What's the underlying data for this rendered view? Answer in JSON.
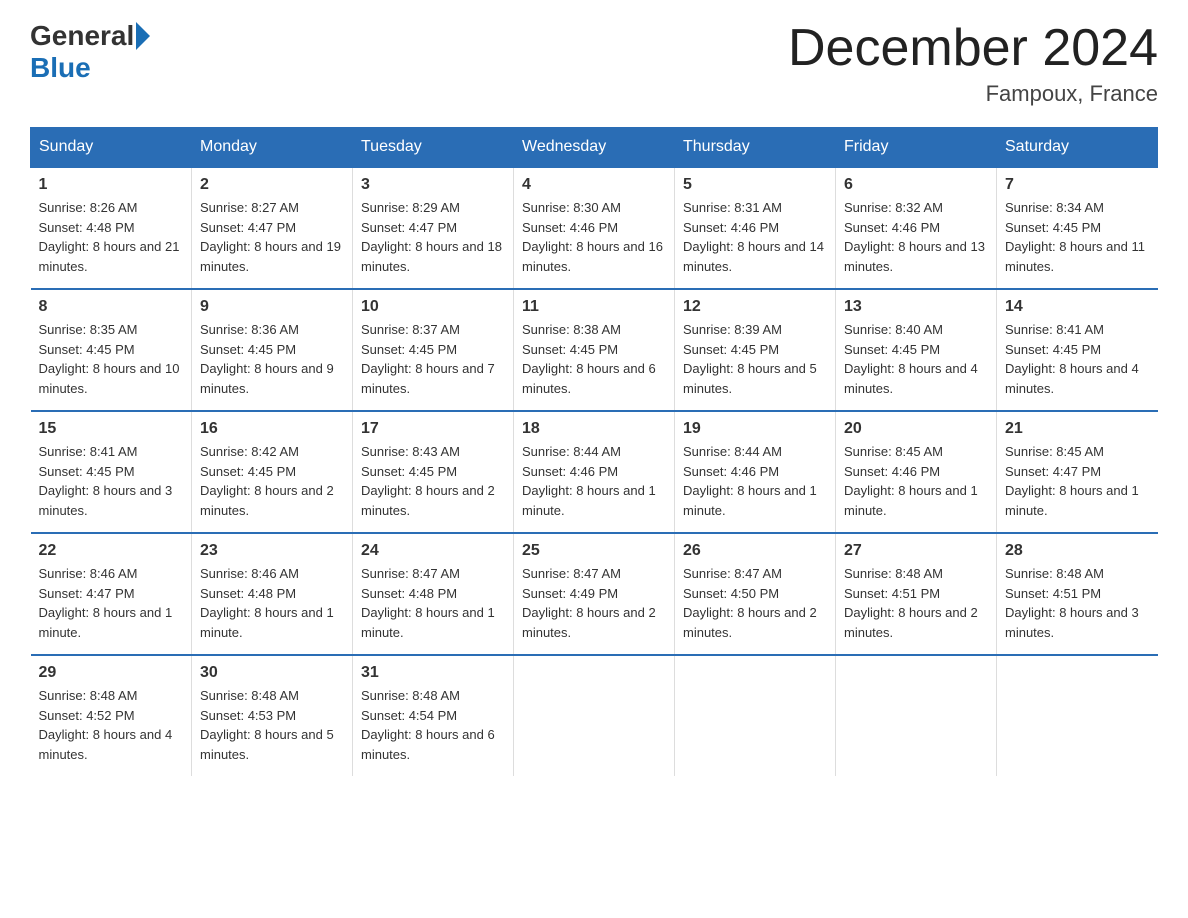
{
  "header": {
    "logo_general": "General",
    "logo_blue": "Blue",
    "title": "December 2024",
    "location": "Fampoux, France"
  },
  "days_of_week": [
    "Sunday",
    "Monday",
    "Tuesday",
    "Wednesday",
    "Thursday",
    "Friday",
    "Saturday"
  ],
  "weeks": [
    [
      {
        "day": "1",
        "sunrise": "8:26 AM",
        "sunset": "4:48 PM",
        "daylight": "8 hours and 21 minutes."
      },
      {
        "day": "2",
        "sunrise": "8:27 AM",
        "sunset": "4:47 PM",
        "daylight": "8 hours and 19 minutes."
      },
      {
        "day": "3",
        "sunrise": "8:29 AM",
        "sunset": "4:47 PM",
        "daylight": "8 hours and 18 minutes."
      },
      {
        "day": "4",
        "sunrise": "8:30 AM",
        "sunset": "4:46 PM",
        "daylight": "8 hours and 16 minutes."
      },
      {
        "day": "5",
        "sunrise": "8:31 AM",
        "sunset": "4:46 PM",
        "daylight": "8 hours and 14 minutes."
      },
      {
        "day": "6",
        "sunrise": "8:32 AM",
        "sunset": "4:46 PM",
        "daylight": "8 hours and 13 minutes."
      },
      {
        "day": "7",
        "sunrise": "8:34 AM",
        "sunset": "4:45 PM",
        "daylight": "8 hours and 11 minutes."
      }
    ],
    [
      {
        "day": "8",
        "sunrise": "8:35 AM",
        "sunset": "4:45 PM",
        "daylight": "8 hours and 10 minutes."
      },
      {
        "day": "9",
        "sunrise": "8:36 AM",
        "sunset": "4:45 PM",
        "daylight": "8 hours and 9 minutes."
      },
      {
        "day": "10",
        "sunrise": "8:37 AM",
        "sunset": "4:45 PM",
        "daylight": "8 hours and 7 minutes."
      },
      {
        "day": "11",
        "sunrise": "8:38 AM",
        "sunset": "4:45 PM",
        "daylight": "8 hours and 6 minutes."
      },
      {
        "day": "12",
        "sunrise": "8:39 AM",
        "sunset": "4:45 PM",
        "daylight": "8 hours and 5 minutes."
      },
      {
        "day": "13",
        "sunrise": "8:40 AM",
        "sunset": "4:45 PM",
        "daylight": "8 hours and 4 minutes."
      },
      {
        "day": "14",
        "sunrise": "8:41 AM",
        "sunset": "4:45 PM",
        "daylight": "8 hours and 4 minutes."
      }
    ],
    [
      {
        "day": "15",
        "sunrise": "8:41 AM",
        "sunset": "4:45 PM",
        "daylight": "8 hours and 3 minutes."
      },
      {
        "day": "16",
        "sunrise": "8:42 AM",
        "sunset": "4:45 PM",
        "daylight": "8 hours and 2 minutes."
      },
      {
        "day": "17",
        "sunrise": "8:43 AM",
        "sunset": "4:45 PM",
        "daylight": "8 hours and 2 minutes."
      },
      {
        "day": "18",
        "sunrise": "8:44 AM",
        "sunset": "4:46 PM",
        "daylight": "8 hours and 1 minute."
      },
      {
        "day": "19",
        "sunrise": "8:44 AM",
        "sunset": "4:46 PM",
        "daylight": "8 hours and 1 minute."
      },
      {
        "day": "20",
        "sunrise": "8:45 AM",
        "sunset": "4:46 PM",
        "daylight": "8 hours and 1 minute."
      },
      {
        "day": "21",
        "sunrise": "8:45 AM",
        "sunset": "4:47 PM",
        "daylight": "8 hours and 1 minute."
      }
    ],
    [
      {
        "day": "22",
        "sunrise": "8:46 AM",
        "sunset": "4:47 PM",
        "daylight": "8 hours and 1 minute."
      },
      {
        "day": "23",
        "sunrise": "8:46 AM",
        "sunset": "4:48 PM",
        "daylight": "8 hours and 1 minute."
      },
      {
        "day": "24",
        "sunrise": "8:47 AM",
        "sunset": "4:48 PM",
        "daylight": "8 hours and 1 minute."
      },
      {
        "day": "25",
        "sunrise": "8:47 AM",
        "sunset": "4:49 PM",
        "daylight": "8 hours and 2 minutes."
      },
      {
        "day": "26",
        "sunrise": "8:47 AM",
        "sunset": "4:50 PM",
        "daylight": "8 hours and 2 minutes."
      },
      {
        "day": "27",
        "sunrise": "8:48 AM",
        "sunset": "4:51 PM",
        "daylight": "8 hours and 2 minutes."
      },
      {
        "day": "28",
        "sunrise": "8:48 AM",
        "sunset": "4:51 PM",
        "daylight": "8 hours and 3 minutes."
      }
    ],
    [
      {
        "day": "29",
        "sunrise": "8:48 AM",
        "sunset": "4:52 PM",
        "daylight": "8 hours and 4 minutes."
      },
      {
        "day": "30",
        "sunrise": "8:48 AM",
        "sunset": "4:53 PM",
        "daylight": "8 hours and 5 minutes."
      },
      {
        "day": "31",
        "sunrise": "8:48 AM",
        "sunset": "4:54 PM",
        "daylight": "8 hours and 6 minutes."
      },
      null,
      null,
      null,
      null
    ]
  ]
}
